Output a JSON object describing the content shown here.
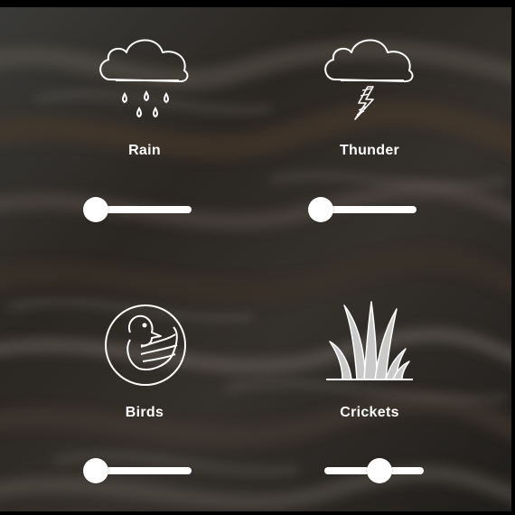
{
  "sounds": [
    {
      "id": "rain",
      "label": "Rain",
      "icon": "rain-cloud-icon",
      "volume": 0.0
    },
    {
      "id": "thunder",
      "label": "Thunder",
      "icon": "thunder-cloud-icon",
      "volume": 0.0
    },
    {
      "id": "birds",
      "label": "Birds",
      "icon": "bird-icon",
      "volume": 0.0
    },
    {
      "id": "crickets",
      "label": "Crickets",
      "icon": "grass-icon",
      "volume": 0.62
    }
  ],
  "colors": {
    "text": "#ffffff",
    "slider": "#ffffff",
    "background": "#2b2b2b"
  }
}
